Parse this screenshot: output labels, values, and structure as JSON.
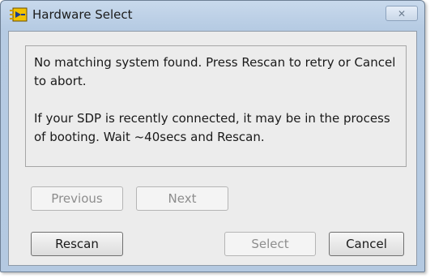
{
  "window": {
    "title": "Hardware Select",
    "close_label": "✕"
  },
  "message": {
    "line1": "No matching system found. Press Rescan to retry or Cancel to abort.",
    "line2": "If your SDP is recently connected, it may be in the process of booting. Wait ~40secs and Rescan."
  },
  "buttons": {
    "previous": "Previous",
    "next": "Next",
    "rescan": "Rescan",
    "select": "Select",
    "cancel": "Cancel"
  },
  "colors": {
    "titlebar": "#b6cbe3",
    "client_bg": "#ececec",
    "disabled_text": "#8d8d8d"
  },
  "icons": {
    "app": "labview-app-icon",
    "close": "close-icon"
  }
}
